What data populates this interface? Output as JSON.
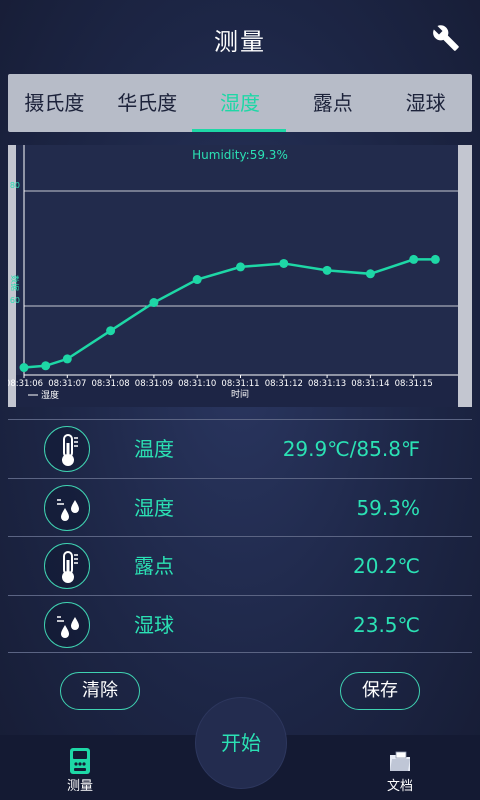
{
  "header": {
    "title": "测量"
  },
  "tabs": [
    {
      "label": "摄氏度",
      "active": false
    },
    {
      "label": "华氏度",
      "active": false
    },
    {
      "label": "湿度",
      "active": true
    },
    {
      "label": "露点",
      "active": false
    },
    {
      "label": "湿球",
      "active": false
    }
  ],
  "chart": {
    "title": "Humidity:59.3%",
    "ylabel": "数据",
    "xlabel": "时间",
    "legend": "湿度"
  },
  "chart_data": {
    "type": "line",
    "title": "Humidity:59.3%",
    "xlabel": "时间",
    "ylabel": "数据",
    "ylim": [
      48,
      88
    ],
    "yticks": [
      "80",
      "60"
    ],
    "categories": [
      "08:31:06",
      "08:31:07",
      "08:31:08",
      "08:31:09",
      "08:31:10",
      "08:31:11",
      "08:31:12",
      "08:31:13",
      "08:31:14",
      "08:31:15"
    ],
    "series": [
      {
        "name": "湿度",
        "x": [
          "08:31:06",
          "08:31:06.5",
          "08:31:07",
          "08:31:08",
          "08:31:09",
          "08:31:10",
          "08:31:11",
          "08:31:12",
          "08:31:13",
          "08:31:14",
          "08:31:15",
          "08:31:15.5"
        ],
        "values": [
          49.3,
          49.6,
          50.8,
          55.7,
          60.6,
          64.6,
          66.8,
          67.4,
          66.2,
          65.6,
          68.1,
          68.1
        ]
      }
    ],
    "grid": true,
    "color": "#1ed7a6"
  },
  "readings": [
    {
      "label": "温度",
      "value": "29.9℃/85.8℉",
      "icon": "thermometer-icon"
    },
    {
      "label": "湿度",
      "value": "59.3%",
      "icon": "humidity-drops-icon"
    },
    {
      "label": "露点",
      "value": "20.2℃",
      "icon": "thermometer-icon"
    },
    {
      "label": "湿球",
      "value": "23.5℃",
      "icon": "humidity-drops-icon"
    }
  ],
  "buttons": {
    "clear": "清除",
    "save": "保存",
    "start": "开始"
  },
  "nav": {
    "measure": "测量",
    "docs": "文档"
  },
  "colors": {
    "accent": "#1ed7a6",
    "background": "#1d2646"
  }
}
